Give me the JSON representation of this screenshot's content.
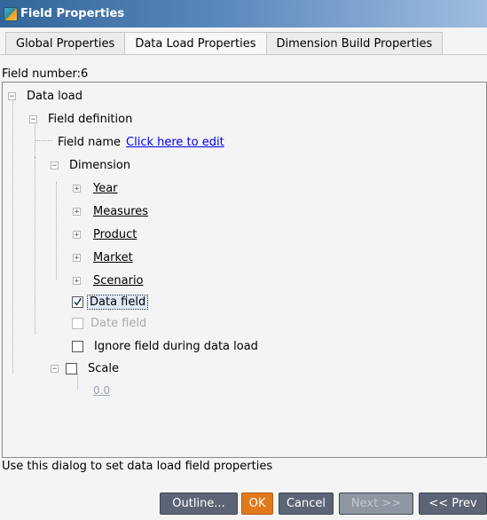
{
  "window": {
    "title": "Field Properties"
  },
  "tabs": [
    {
      "label": "Global Properties"
    },
    {
      "label": "Data Load Properties"
    },
    {
      "label": "Dimension Build Properties"
    }
  ],
  "field_number": "Field number:6",
  "tree": {
    "data_load": "Data load",
    "field_definition": "Field definition",
    "field_name_label": "Field name",
    "field_name_link": "Click here to edit",
    "dimension": "Dimension",
    "dimensions": [
      "Year",
      "Measures",
      "Product",
      "Market",
      "Scenario"
    ],
    "data_field": "Data field",
    "date_field": "Date field",
    "ignore_field": "Ignore field during data load",
    "scale": "Scale",
    "scale_value": "0.0"
  },
  "status_text": "Use this dialog to set data load field properties",
  "buttons": {
    "outline": "Outline...",
    "ok": "OK",
    "cancel": "Cancel",
    "next": "Next >>",
    "prev": "<< Prev"
  },
  "colors": {
    "titlebar_start": "#33659a",
    "button": "#5b6575",
    "ok_button": "#e0791c",
    "link": "#0000ee"
  }
}
